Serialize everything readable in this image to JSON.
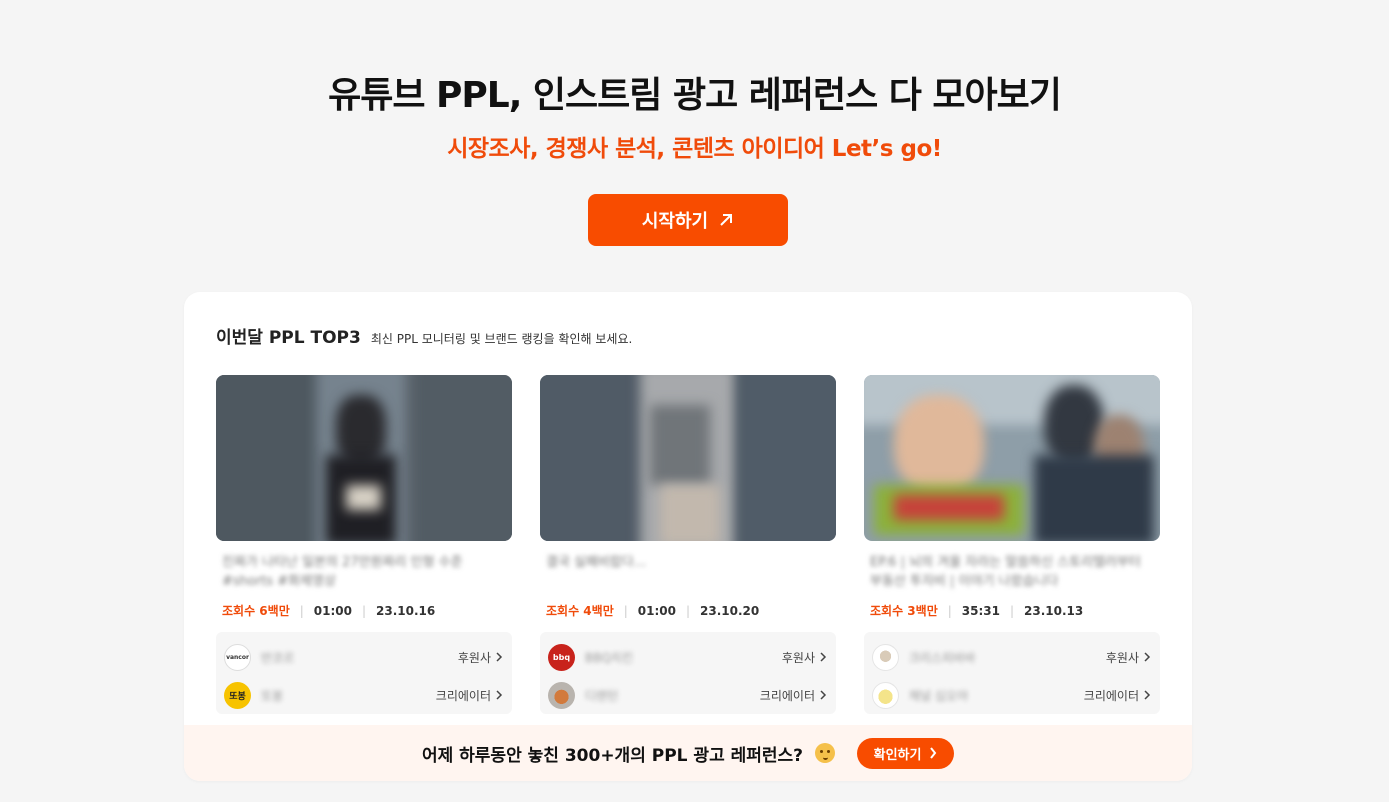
{
  "hero": {
    "title": "유튜브 PPL, 인스트림 광고 레퍼런스 다 모아보기",
    "subtitle": "시장조사, 경쟁사 분석, 콘텐츠 아이디어 Let’s go!",
    "start_label": "시작하기",
    "start_icon": "arrow-up-right-icon"
  },
  "colors": {
    "accent": "#f84c00",
    "accent_text": "#f04b0a",
    "banner_bg": "#fff5f0",
    "page_bg": "#f5f5f5"
  },
  "top3": {
    "title": "이번달 PPL TOP3",
    "description": "최신 PPL 모니터링 및 브랜드 랭킹을 확인해 보세요.",
    "items": [
      {
        "title": "진짜가 나타난 일본의 27만원짜리 인형 수준 #shorts #화제영상",
        "views": "조회수 6백만",
        "duration": "01:00",
        "date": "23.10.16",
        "sponsor": {
          "name": "반코르",
          "link_label": "후원사",
          "logo_text": "vancor"
        },
        "creator": {
          "name": "또봉",
          "link_label": "크리에이터",
          "logo_text": "또봉"
        }
      },
      {
        "title": "결국 실패비랍다...",
        "views": "조회수 4백만",
        "duration": "01:00",
        "date": "23.10.20",
        "sponsor": {
          "name": "BBQ치킨",
          "link_label": "후원사",
          "logo_text": "bbq"
        },
        "creator": {
          "name": "디렌턴",
          "link_label": "크리에이터",
          "logo_text": ""
        }
      },
      {
        "title": "EP.6 | 뇌의 겨울 자라는 말씀하신 스토리텔러부터 부동산 투자비 | 이야기 나왔습니다",
        "views": "조회수 3백만",
        "duration": "35:31",
        "date": "23.10.13",
        "sponsor": {
          "name": "크리스피바바",
          "link_label": "후원사",
          "logo_text": ""
        },
        "creator": {
          "name": "채널 십오야",
          "link_label": "크리에이터",
          "logo_text": ""
        }
      }
    ]
  },
  "banner": {
    "text": "어제 하루동안 놓친 300+개의 PPL 광고 레퍼런스?",
    "emoji_icon": "thinking-face-icon",
    "button_label": "확인하기"
  }
}
